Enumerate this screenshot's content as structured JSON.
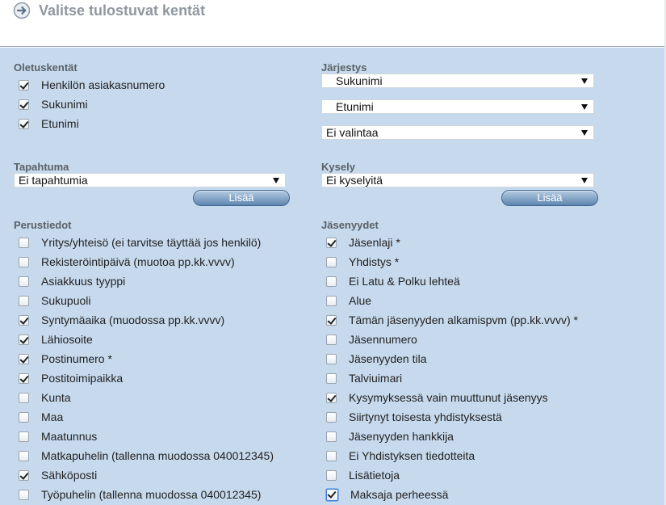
{
  "header": {
    "title": "Valitse tulostuvat kentät",
    "icon": "arrow-circle-right-icon"
  },
  "colors": {
    "panel": "#c7d9ed",
    "button": "#5f86b0",
    "header_text": "#9097a0"
  },
  "oletuskentat": {
    "title": "Oletuskentät",
    "items": [
      {
        "label": "Henkilön asiakasnumero",
        "checked": true
      },
      {
        "label": "Sukunimi",
        "checked": true
      },
      {
        "label": "Etunimi",
        "checked": true
      }
    ]
  },
  "jarjestys": {
    "title": "Järjestys",
    "selects": [
      "Sukunimi",
      "Etunimi",
      "Ei valintaa"
    ]
  },
  "tapahtuma": {
    "title": "Tapahtuma",
    "value": "Ei tapahtumia",
    "button": "Lisää"
  },
  "kysely": {
    "title": "Kysely",
    "value": "Ei kyselyitä",
    "button": "Lisää"
  },
  "perustiedot": {
    "title": "Perustiedot",
    "items": [
      {
        "label": "Yritys/yhteisö (ei tarvitse täyttää jos henkilö)",
        "checked": false
      },
      {
        "label": "Rekisteröintipäivä (muotoa pp.kk.vvvv)",
        "checked": false
      },
      {
        "label": "Asiakkuus tyyppi",
        "checked": false
      },
      {
        "label": "Sukupuoli",
        "checked": false
      },
      {
        "label": "Syntymäaika (muodossa pp.kk.vvvv)",
        "checked": true
      },
      {
        "label": "Lähiosoite",
        "checked": true
      },
      {
        "label": "Postinumero *",
        "checked": true
      },
      {
        "label": "Postitoimipaikka",
        "checked": true
      },
      {
        "label": "Kunta",
        "checked": false
      },
      {
        "label": "Maa",
        "checked": false
      },
      {
        "label": "Maatunnus",
        "checked": false
      },
      {
        "label": "Matkapuhelin (tallenna muodossa 040012345)",
        "checked": false
      },
      {
        "label": "Sähköposti",
        "checked": true
      },
      {
        "label": "Työpuhelin (tallenna muodossa 040012345)",
        "checked": false
      }
    ]
  },
  "jasenyydet": {
    "title": "Jäsenyydet",
    "items": [
      {
        "label": "Jäsenlaji *",
        "checked": true
      },
      {
        "label": "Yhdistys *",
        "checked": false
      },
      {
        "label": "Ei Latu & Polku lehteä",
        "checked": false
      },
      {
        "label": "Alue",
        "checked": false
      },
      {
        "label": "Tämän jäsenyyden alkamispvm (pp.kk.vvvv) *",
        "checked": true
      },
      {
        "label": "Jäsennumero",
        "checked": false
      },
      {
        "label": "Jäsenyyden tila",
        "checked": false
      },
      {
        "label": "Talviuimari",
        "checked": false
      },
      {
        "label": "Kysymyksessä vain muuttunut jäsenyys",
        "checked": true
      },
      {
        "label": "Siirtynyt toisesta yhdistyksestä",
        "checked": false
      },
      {
        "label": "Jäsenyyden hankkija",
        "checked": false
      },
      {
        "label": "Ei Yhdistyksen tiedotteita",
        "checked": false
      },
      {
        "label": "Lisätietoja",
        "checked": false
      },
      {
        "label": "Maksaja perheessä",
        "checked": true,
        "focused": true
      }
    ]
  }
}
